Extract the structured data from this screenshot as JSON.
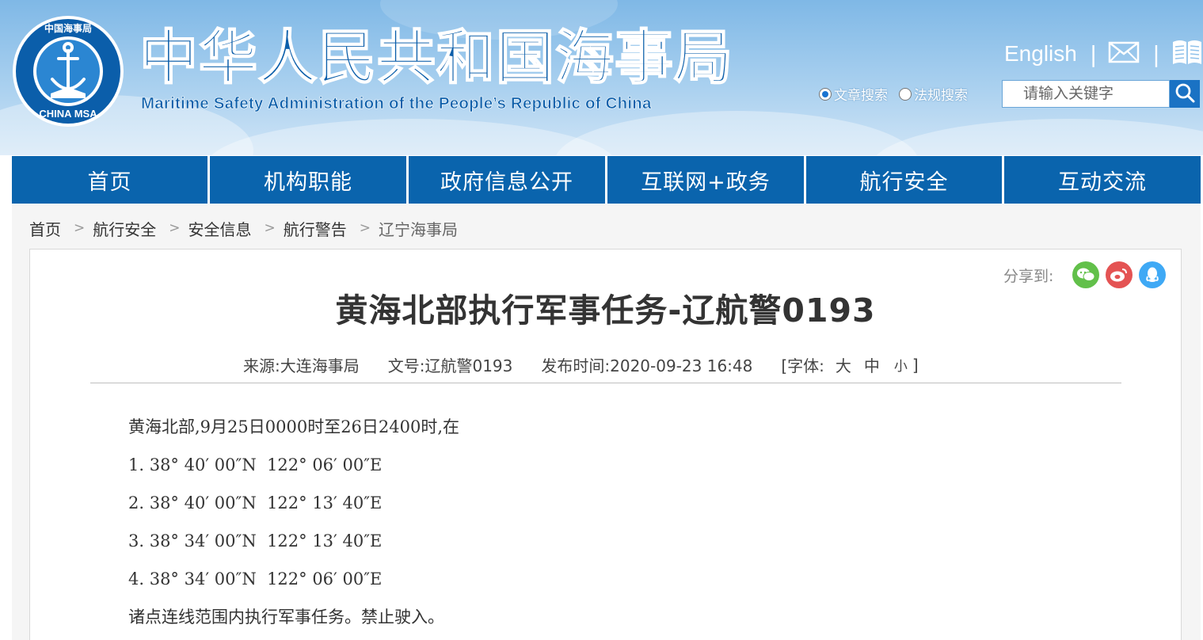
{
  "site": {
    "title_zh": "中华人民共和国海事局",
    "title_en": "Maritime Safety Administration of the People’s Republic of China",
    "logo_text_top": "中国海事局",
    "logo_text_bottom": "CHINA MSA"
  },
  "top_links": {
    "english": "English",
    "separator": "|",
    "mail_icon": "mail-icon",
    "book_icon": "book-icon"
  },
  "search": {
    "options": [
      {
        "label": "文章搜索",
        "checked": true
      },
      {
        "label": "法规搜索",
        "checked": false
      }
    ],
    "placeholder": "请输入关键字"
  },
  "nav": {
    "items": [
      {
        "label": "首页"
      },
      {
        "label": "机构职能"
      },
      {
        "label": "政府信息公开"
      },
      {
        "label": "互联网+政务"
      },
      {
        "label": "航行安全"
      },
      {
        "label": "互动交流"
      }
    ]
  },
  "breadcrumb": {
    "items": [
      "首页",
      "航行安全",
      "安全信息",
      "航行警告",
      "辽宁海事局"
    ],
    "separator": ">"
  },
  "share": {
    "label": "分享到:",
    "targets": [
      {
        "name": "wechat",
        "color": "#62c04a"
      },
      {
        "name": "weibo",
        "color": "#e45353"
      },
      {
        "name": "qq",
        "color": "#3fa9f5"
      }
    ]
  },
  "article": {
    "title": "黄海北部执行军事任务-辽航警0193",
    "source": "来源:大连海事局",
    "doc_no": "文号:辽航警0193",
    "publish_time": "发布时间:2020-09-23 16:48",
    "font_size_open": "[字体:",
    "font_large": "大",
    "font_medium": "中",
    "font_small": "小",
    "font_size_close": "]",
    "paragraphs": [
      "黄海北部,9月25日0000时至26日2400时,在",
      "1. 38° 40′ 00″N  122° 06′ 00″E",
      "2. 38° 40′ 00″N  122° 13′ 40″E",
      "3. 38° 34′ 00″N  122° 13′ 40″E",
      "4. 38° 34′ 00″N  122° 06′ 00″E",
      "诸点连线范围内执行军事任务。禁止驶入。"
    ]
  },
  "colors": {
    "brand_blue": "#0a64ad",
    "header_sky": "#a9d0ef"
  }
}
